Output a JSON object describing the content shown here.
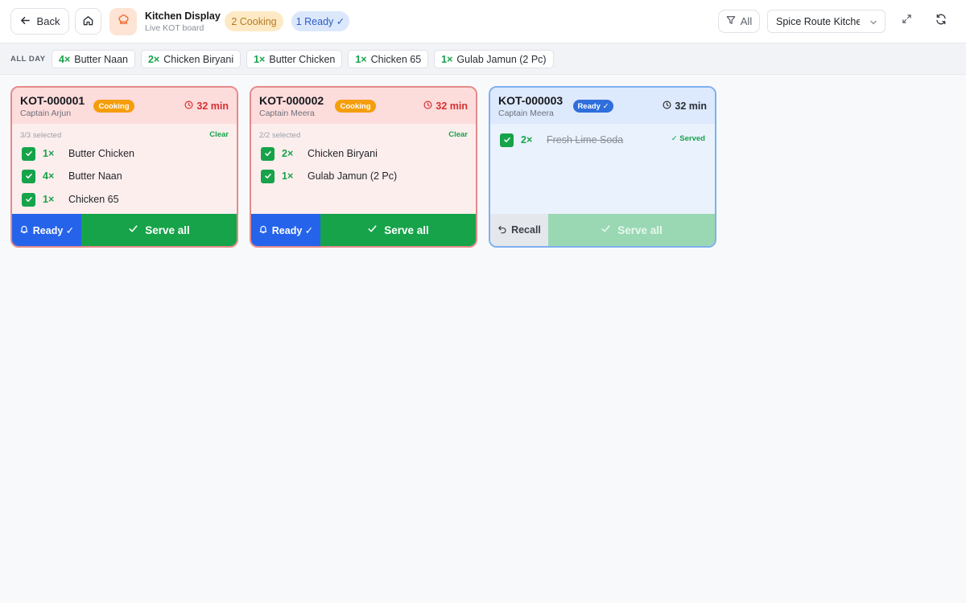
{
  "header": {
    "back_label": "Back",
    "app_title": "Kitchen Display",
    "app_subtitle": "Live KOT board",
    "cooking_pill": "2 Cooking",
    "ready_pill": "1 Ready ✓",
    "filter_label": "All",
    "kitchen_select": "Spice Route Kitchen",
    "accent_color": "#f0703a"
  },
  "all_day": {
    "label": "ALL DAY",
    "chips": [
      {
        "qty": "4×",
        "name": "Butter Naan"
      },
      {
        "qty": "2×",
        "name": "Chicken Biryani"
      },
      {
        "qty": "1×",
        "name": "Butter Chicken"
      },
      {
        "qty": "1×",
        "name": "Chicken 65"
      },
      {
        "qty": "1×",
        "name": "Gulab Jamun (2 Pc)"
      }
    ]
  },
  "tickets": [
    {
      "id": "KOT-000001",
      "captain": "Captain Arjun",
      "status": "Cooking",
      "timer": "32 min",
      "selected": "3/3 selected",
      "clear": "Clear",
      "items": [
        {
          "qty": "1×",
          "name": "Butter Chicken"
        },
        {
          "qty": "4×",
          "name": "Butter Naan"
        },
        {
          "qty": "1×",
          "name": "Chicken 65"
        }
      ],
      "ready_btn": "Ready ✓",
      "serve_btn": "Serve all"
    },
    {
      "id": "KOT-000002",
      "captain": "Captain Meera",
      "status": "Cooking",
      "timer": "32 min",
      "selected": "2/2 selected",
      "clear": "Clear",
      "items": [
        {
          "qty": "2×",
          "name": "Chicken Biryani"
        },
        {
          "qty": "1×",
          "name": "Gulab Jamun (2 Pc)"
        }
      ],
      "ready_btn": "Ready ✓",
      "serve_btn": "Serve all"
    },
    {
      "id": "KOT-000003",
      "captain": "Captain Meera",
      "status": "Ready ✓",
      "timer": "32 min",
      "items": [
        {
          "qty": "2×",
          "name": "Fresh Lime Soda",
          "served": "✓ Served"
        }
      ],
      "recall_btn": "Recall",
      "serve_btn": "Serve all"
    }
  ]
}
